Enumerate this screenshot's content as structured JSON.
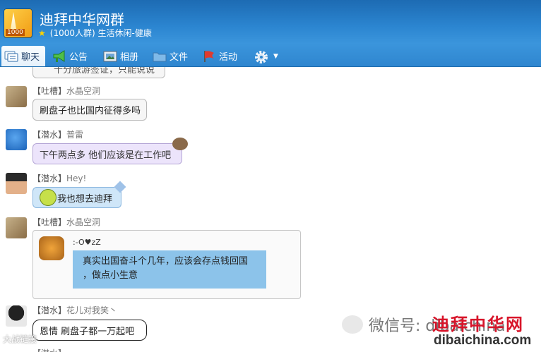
{
  "header": {
    "group_name": "迪拜中华网群",
    "member_count": "(1000人群)",
    "category": "生活休闲-健康",
    "logo_badge": "1000"
  },
  "tabs": [
    {
      "label": "聊天",
      "active": true,
      "icon": "chat-icon"
    },
    {
      "label": "公告",
      "icon": "megaphone-icon"
    },
    {
      "label": "相册",
      "icon": "photo-album-icon"
    },
    {
      "label": "文件",
      "icon": "folder-icon"
    },
    {
      "label": "活动",
      "icon": "flag-icon"
    },
    {
      "label": "",
      "icon": "gear-icon"
    }
  ],
  "messages": [
    {
      "text_partial": "十分旅游签证，只能说说"
    },
    {
      "tag": "【吐槽】",
      "name": "水晶空洞",
      "text": "刷盘子也比国内征得多吗"
    },
    {
      "tag": "【潜水】",
      "name": "普雷",
      "text": "下午两点多 他们应该是在工作吧"
    },
    {
      "tag": "【潜水】",
      "name": "Hey!",
      "text": "我也想去迪拜"
    },
    {
      "tag": "【吐槽】",
      "name": "水晶空洞",
      "card_caption": ":-O♥zZ",
      "card_text_1": "真实出国奋斗个几年，应该会存点钱回国",
      "card_text_2": "，做点小生意"
    },
    {
      "tag": "【潜水】",
      "name": "花儿对我笑丶",
      "text": "恩情 刷盘子都一万起吧"
    }
  ],
  "watermarks": {
    "left": "大战链接",
    "wechat": "微信号: dibaichina",
    "brand": "迪拜中华网",
    "domain": "dibaichina.com"
  },
  "colors": {
    "header": "#2b85d0",
    "purple_bubble": "#ece4fb",
    "blue_bubble": "#cfe6f8"
  }
}
